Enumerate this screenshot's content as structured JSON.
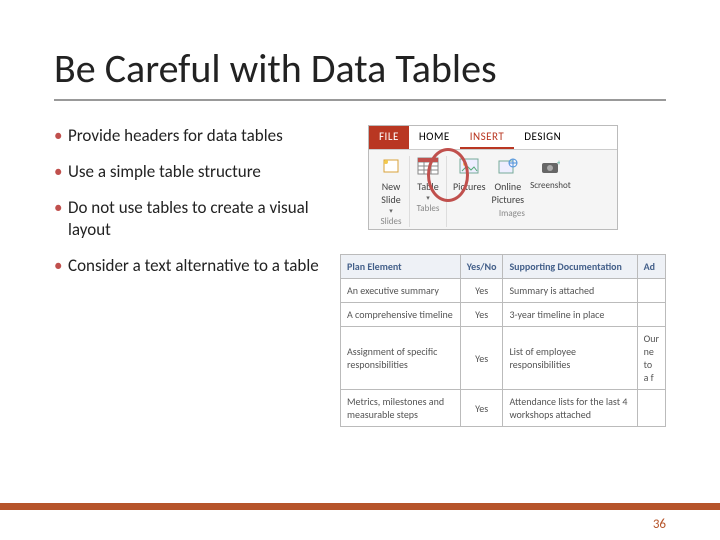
{
  "title": "Be Careful with Data Tables",
  "bullets": [
    "Provide headers for data tables",
    "Use a simple table structure",
    "Do not use tables to create a visual layout",
    "Consider a text alternative to a table"
  ],
  "ribbon": {
    "tabs": {
      "file": "FILE",
      "home": "HOME",
      "insert": "INSERT",
      "design": "DESIGN"
    },
    "buttons": {
      "new_slide": "New\nSlide",
      "table": "Table",
      "pictures": "Pictures",
      "online_pictures": "Online\nPictures",
      "screenshot": "Screenshot"
    },
    "groups": {
      "slides": "Slides",
      "tables": "Tables",
      "images": "Images"
    }
  },
  "sample_table": {
    "headers": [
      "Plan Element",
      "Yes/No",
      "Supporting Documentation",
      "Ad"
    ],
    "rows": [
      [
        "An executive summary",
        "Yes",
        "Summary is attached",
        ""
      ],
      [
        "A comprehensive timeline",
        "Yes",
        "3-year timeline in place",
        ""
      ],
      [
        "Assignment of specific responsibilities",
        "Yes",
        "List of employee responsibilities",
        "Our ne\nto a f"
      ],
      [
        "Metrics, milestones and measurable steps",
        "Yes",
        "Attendance lists for the last 4 workshops attached",
        ""
      ]
    ]
  },
  "page_number": "36"
}
